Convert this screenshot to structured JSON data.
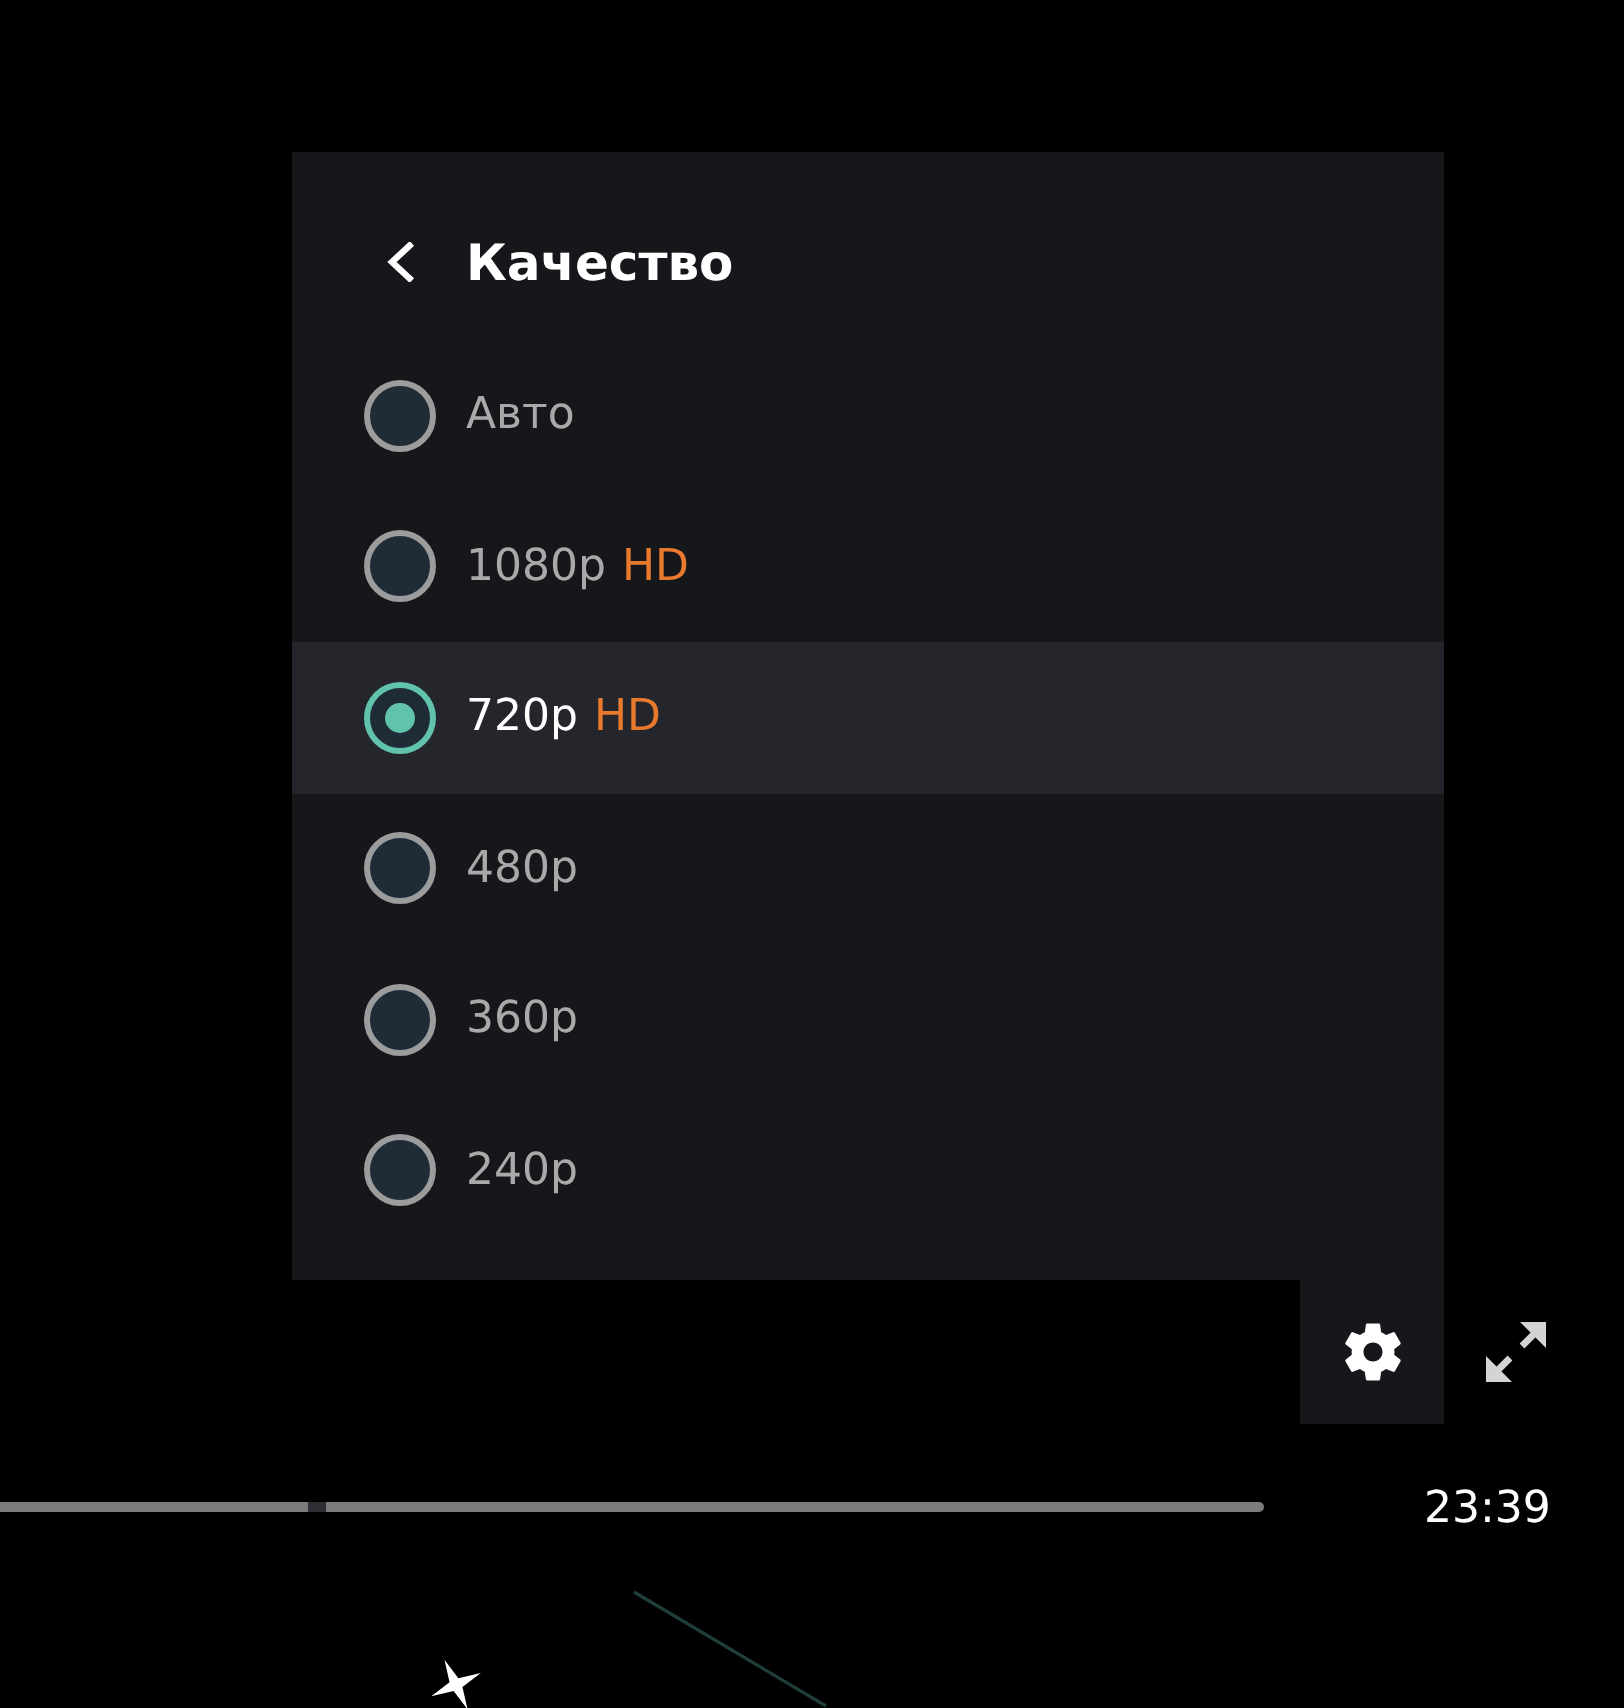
{
  "menu": {
    "title": "Качество",
    "options": [
      {
        "label": "Авто",
        "selected": false
      },
      {
        "label": "1080p",
        "badge": "HD",
        "selected": false
      },
      {
        "label": "720p",
        "badge": "HD",
        "selected": true
      },
      {
        "label": "480p",
        "selected": false
      },
      {
        "label": "360p",
        "selected": false
      },
      {
        "label": "240p",
        "selected": false
      }
    ]
  },
  "controls": {
    "settings_button": {
      "expanded": true
    },
    "seek_bar": {
      "level": 0.25
    },
    "time": "23:39"
  }
}
